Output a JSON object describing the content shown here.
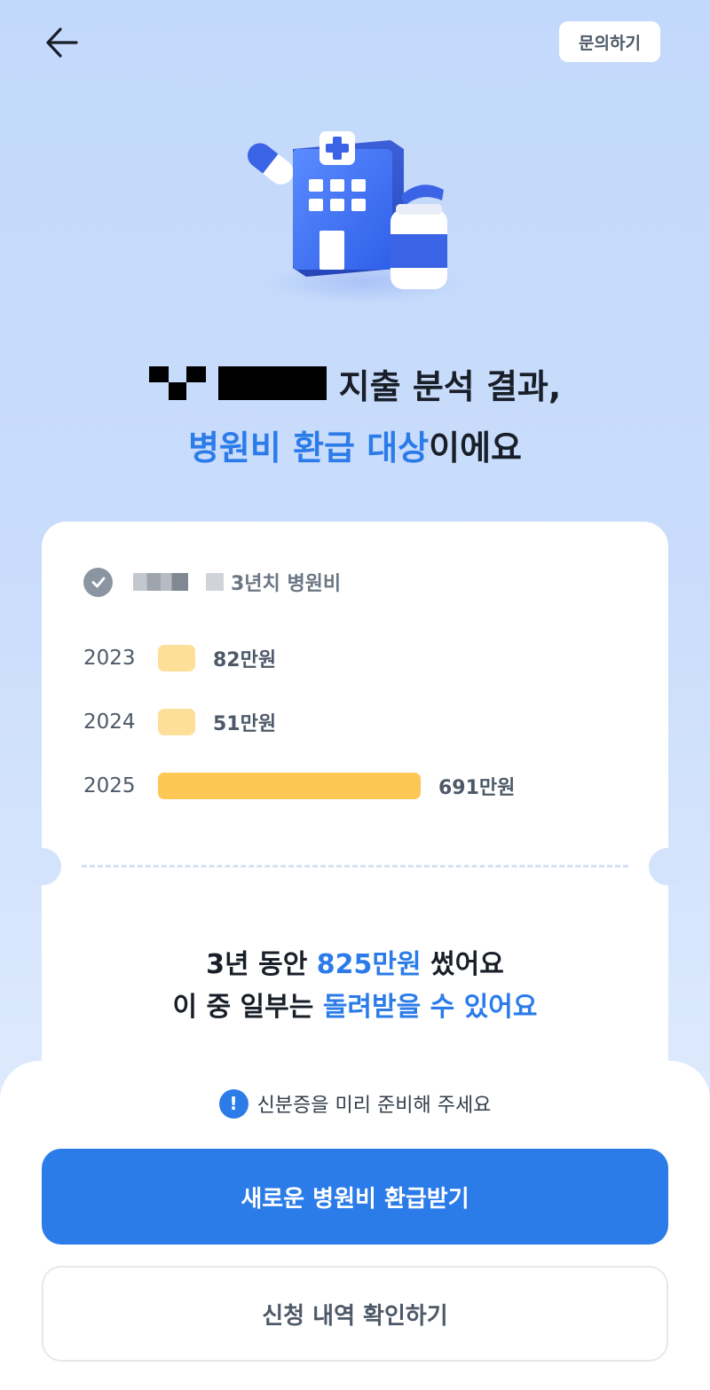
{
  "header": {
    "back_icon": "arrow-left-icon",
    "inquiry_label": "문의하기"
  },
  "hero": {
    "icons": [
      "hospital-icon",
      "pill-icon",
      "medicine-bottle-icon"
    ]
  },
  "heading": {
    "line1_suffix": "지출 분석 결과,",
    "line2_highlight": "병원비 환급 대상",
    "line2_suffix": "이에요"
  },
  "card": {
    "title": "3년치 병원비",
    "expenses": [
      {
        "year": "2023",
        "amount_label": "82만원",
        "amount": 82
      },
      {
        "year": "2024",
        "amount_label": "51만원",
        "amount": 51
      },
      {
        "year": "2025",
        "amount_label": "691만원",
        "amount": 691
      }
    ],
    "summary": {
      "l1_prefix": "3년 동안 ",
      "l1_highlight": "825만원",
      "l1_suffix": " 썼어요",
      "l2_prefix": "이 중 일부는 ",
      "l2_highlight": "돌려받을 수 있어요"
    }
  },
  "notice": {
    "icon": "info-icon",
    "text": "신분증을 미리 준비해 주세요"
  },
  "buttons": {
    "primary": "새로운 병원비 환급받기",
    "secondary": "신청 내역 확인하기"
  },
  "colors": {
    "accent": "#2b7be9",
    "bar_low": "#fedf9a",
    "bar_high": "#fdc755"
  }
}
